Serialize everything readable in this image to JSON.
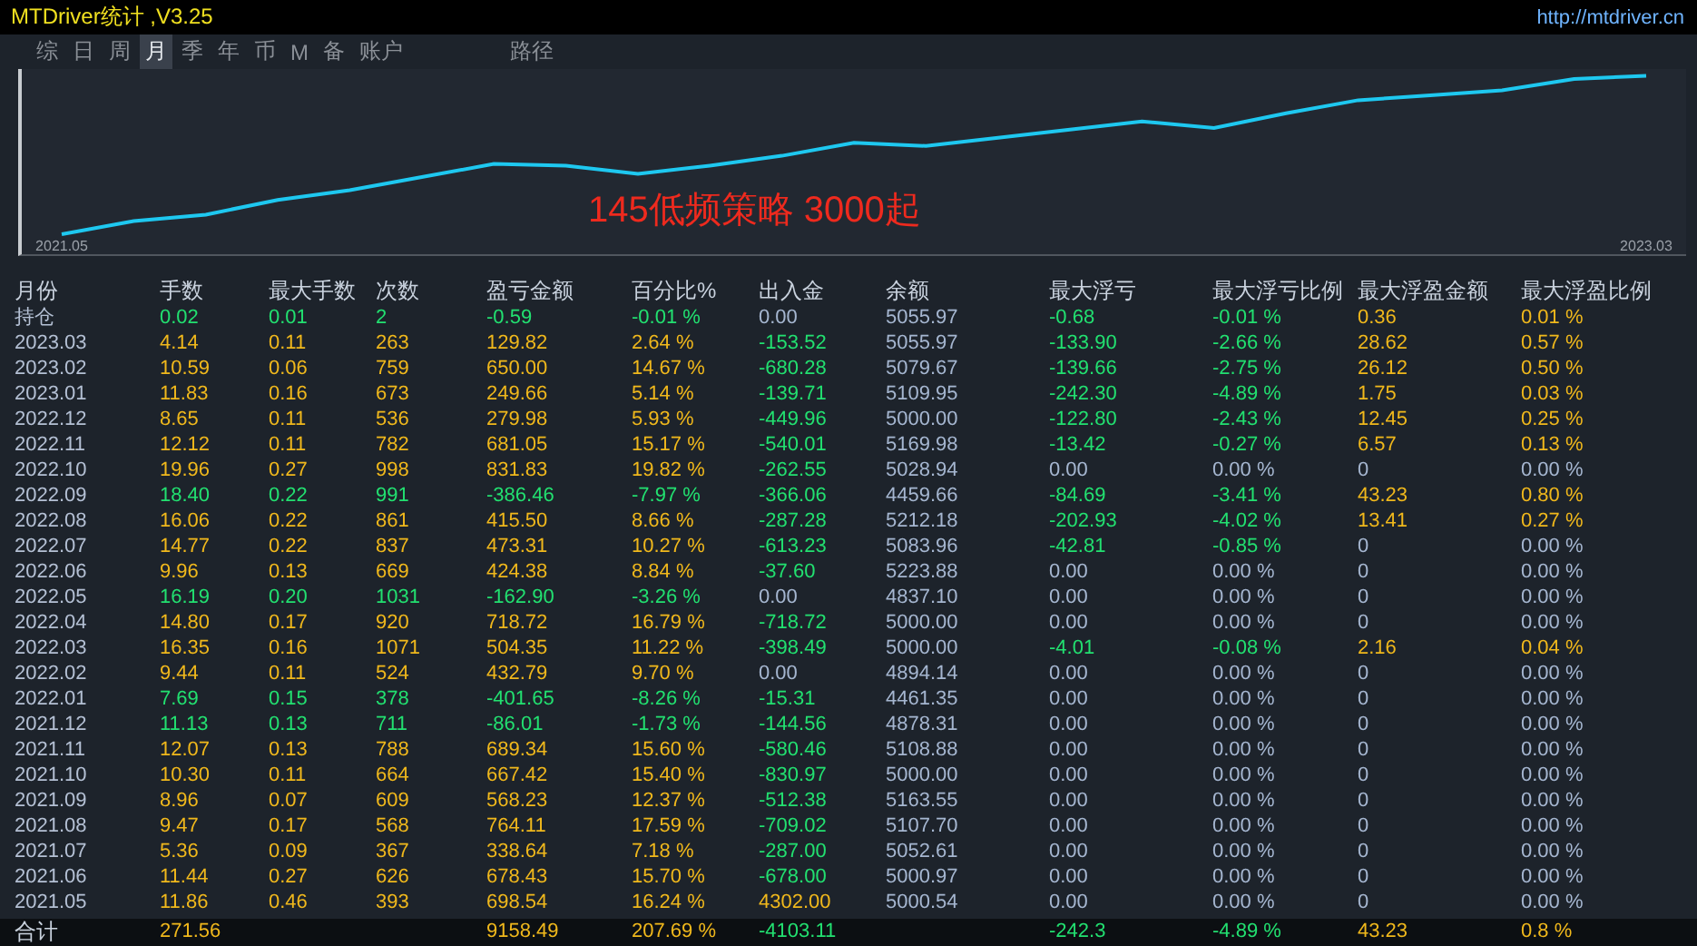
{
  "window": {
    "title": "MTDriver统计 ,V3.25",
    "link": "http://mtdriver.cn"
  },
  "tabs": [
    {
      "label": "综",
      "selected": false
    },
    {
      "label": "日",
      "selected": false
    },
    {
      "label": "周",
      "selected": false
    },
    {
      "label": "月",
      "selected": true
    },
    {
      "label": "季",
      "selected": false
    },
    {
      "label": "年",
      "selected": false
    },
    {
      "label": "币",
      "selected": false
    },
    {
      "label": "M",
      "selected": false
    },
    {
      "label": "备",
      "selected": false
    },
    {
      "label": "账户",
      "selected": false
    }
  ],
  "path_label": "路径",
  "chart": {
    "annotation": "145低频策略 3000起",
    "start_label": "2021.05",
    "end_label": "2023.03"
  },
  "table": {
    "columns": [
      "月份",
      "手数",
      "最大手数",
      "次数",
      "盈亏金额",
      "百分比%",
      "出入金",
      "余额",
      "最大浮亏",
      "最大浮亏比例",
      "最大浮盈金额",
      "最大浮盈比例"
    ],
    "rows": [
      {
        "cells": [
          {
            "text": "持仓",
            "kind": "month"
          },
          {
            "text": "0.02",
            "kind": "down"
          },
          {
            "text": "0.01",
            "kind": "down"
          },
          {
            "text": "2",
            "kind": "down"
          },
          {
            "text": "-0.59",
            "kind": "down"
          },
          {
            "text": "-0.01 %",
            "kind": "down"
          },
          {
            "text": "0.00",
            "kind": "flat"
          },
          {
            "text": "5055.97",
            "kind": "flat"
          },
          {
            "text": "-0.68",
            "kind": "down"
          },
          {
            "text": "-0.01 %",
            "kind": "down"
          },
          {
            "text": "0.36",
            "kind": "up"
          },
          {
            "text": "0.01 %",
            "kind": "up"
          }
        ]
      },
      {
        "cells": [
          {
            "text": "2023.03",
            "kind": "month"
          },
          {
            "text": "4.14",
            "kind": "up"
          },
          {
            "text": "0.11",
            "kind": "up"
          },
          {
            "text": "263",
            "kind": "up"
          },
          {
            "text": "129.82",
            "kind": "up"
          },
          {
            "text": "2.64 %",
            "kind": "up"
          },
          {
            "text": "-153.52",
            "kind": "down"
          },
          {
            "text": "5055.97",
            "kind": "flat"
          },
          {
            "text": "-133.90",
            "kind": "down"
          },
          {
            "text": "-2.66 %",
            "kind": "down"
          },
          {
            "text": "28.62",
            "kind": "up"
          },
          {
            "text": "0.57 %",
            "kind": "up"
          }
        ]
      },
      {
        "cells": [
          {
            "text": "2023.02",
            "kind": "month"
          },
          {
            "text": "10.59",
            "kind": "up"
          },
          {
            "text": "0.06",
            "kind": "up"
          },
          {
            "text": "759",
            "kind": "up"
          },
          {
            "text": "650.00",
            "kind": "up"
          },
          {
            "text": "14.67 %",
            "kind": "up"
          },
          {
            "text": "-680.28",
            "kind": "down"
          },
          {
            "text": "5079.67",
            "kind": "flat"
          },
          {
            "text": "-139.66",
            "kind": "down"
          },
          {
            "text": "-2.75 %",
            "kind": "down"
          },
          {
            "text": "26.12",
            "kind": "up"
          },
          {
            "text": "0.50 %",
            "kind": "up"
          }
        ]
      },
      {
        "cells": [
          {
            "text": "2023.01",
            "kind": "month"
          },
          {
            "text": "11.83",
            "kind": "up"
          },
          {
            "text": "0.16",
            "kind": "up"
          },
          {
            "text": "673",
            "kind": "up"
          },
          {
            "text": "249.66",
            "kind": "up"
          },
          {
            "text": "5.14 %",
            "kind": "up"
          },
          {
            "text": "-139.71",
            "kind": "down"
          },
          {
            "text": "5109.95",
            "kind": "flat"
          },
          {
            "text": "-242.30",
            "kind": "down"
          },
          {
            "text": "-4.89 %",
            "kind": "down"
          },
          {
            "text": "1.75",
            "kind": "up"
          },
          {
            "text": "0.03 %",
            "kind": "up"
          }
        ]
      },
      {
        "cells": [
          {
            "text": "2022.12",
            "kind": "month"
          },
          {
            "text": "8.65",
            "kind": "up"
          },
          {
            "text": "0.11",
            "kind": "up"
          },
          {
            "text": "536",
            "kind": "up"
          },
          {
            "text": "279.98",
            "kind": "up"
          },
          {
            "text": "5.93 %",
            "kind": "up"
          },
          {
            "text": "-449.96",
            "kind": "down"
          },
          {
            "text": "5000.00",
            "kind": "flat"
          },
          {
            "text": "-122.80",
            "kind": "down"
          },
          {
            "text": "-2.43 %",
            "kind": "down"
          },
          {
            "text": "12.45",
            "kind": "up"
          },
          {
            "text": "0.25 %",
            "kind": "up"
          }
        ]
      },
      {
        "cells": [
          {
            "text": "2022.11",
            "kind": "month"
          },
          {
            "text": "12.12",
            "kind": "up"
          },
          {
            "text": "0.11",
            "kind": "up"
          },
          {
            "text": "782",
            "kind": "up"
          },
          {
            "text": "681.05",
            "kind": "up"
          },
          {
            "text": "15.17 %",
            "kind": "up"
          },
          {
            "text": "-540.01",
            "kind": "down"
          },
          {
            "text": "5169.98",
            "kind": "flat"
          },
          {
            "text": "-13.42",
            "kind": "down"
          },
          {
            "text": "-0.27 %",
            "kind": "down"
          },
          {
            "text": "6.57",
            "kind": "up"
          },
          {
            "text": "0.13 %",
            "kind": "up"
          }
        ]
      },
      {
        "cells": [
          {
            "text": "2022.10",
            "kind": "month"
          },
          {
            "text": "19.96",
            "kind": "up"
          },
          {
            "text": "0.27",
            "kind": "up"
          },
          {
            "text": "998",
            "kind": "up"
          },
          {
            "text": "831.83",
            "kind": "up"
          },
          {
            "text": "19.82 %",
            "kind": "up"
          },
          {
            "text": "-262.55",
            "kind": "down"
          },
          {
            "text": "5028.94",
            "kind": "flat"
          },
          {
            "text": "0.00",
            "kind": "flat"
          },
          {
            "text": "0.00 %",
            "kind": "flat"
          },
          {
            "text": "0",
            "kind": "flat"
          },
          {
            "text": "0.00 %",
            "kind": "flat"
          }
        ]
      },
      {
        "cells": [
          {
            "text": "2022.09",
            "kind": "month"
          },
          {
            "text": "18.40",
            "kind": "down"
          },
          {
            "text": "0.22",
            "kind": "down"
          },
          {
            "text": "991",
            "kind": "down"
          },
          {
            "text": "-386.46",
            "kind": "down"
          },
          {
            "text": "-7.97 %",
            "kind": "down"
          },
          {
            "text": "-366.06",
            "kind": "down"
          },
          {
            "text": "4459.66",
            "kind": "flat"
          },
          {
            "text": "-84.69",
            "kind": "down"
          },
          {
            "text": "-3.41 %",
            "kind": "down"
          },
          {
            "text": "43.23",
            "kind": "up"
          },
          {
            "text": "0.80 %",
            "kind": "up"
          }
        ]
      },
      {
        "cells": [
          {
            "text": "2022.08",
            "kind": "month"
          },
          {
            "text": "16.06",
            "kind": "up"
          },
          {
            "text": "0.22",
            "kind": "up"
          },
          {
            "text": "861",
            "kind": "up"
          },
          {
            "text": "415.50",
            "kind": "up"
          },
          {
            "text": "8.66 %",
            "kind": "up"
          },
          {
            "text": "-287.28",
            "kind": "down"
          },
          {
            "text": "5212.18",
            "kind": "flat"
          },
          {
            "text": "-202.93",
            "kind": "down"
          },
          {
            "text": "-4.02 %",
            "kind": "down"
          },
          {
            "text": "13.41",
            "kind": "up"
          },
          {
            "text": "0.27 %",
            "kind": "up"
          }
        ]
      },
      {
        "cells": [
          {
            "text": "2022.07",
            "kind": "month"
          },
          {
            "text": "14.77",
            "kind": "up"
          },
          {
            "text": "0.22",
            "kind": "up"
          },
          {
            "text": "837",
            "kind": "up"
          },
          {
            "text": "473.31",
            "kind": "up"
          },
          {
            "text": "10.27 %",
            "kind": "up"
          },
          {
            "text": "-613.23",
            "kind": "down"
          },
          {
            "text": "5083.96",
            "kind": "flat"
          },
          {
            "text": "-42.81",
            "kind": "down"
          },
          {
            "text": "-0.85 %",
            "kind": "down"
          },
          {
            "text": "0",
            "kind": "flat"
          },
          {
            "text": "0.00 %",
            "kind": "flat"
          }
        ]
      },
      {
        "cells": [
          {
            "text": "2022.06",
            "kind": "month"
          },
          {
            "text": "9.96",
            "kind": "up"
          },
          {
            "text": "0.13",
            "kind": "up"
          },
          {
            "text": "669",
            "kind": "up"
          },
          {
            "text": "424.38",
            "kind": "up"
          },
          {
            "text": "8.84 %",
            "kind": "up"
          },
          {
            "text": "-37.60",
            "kind": "down"
          },
          {
            "text": "5223.88",
            "kind": "flat"
          },
          {
            "text": "0.00",
            "kind": "flat"
          },
          {
            "text": "0.00 %",
            "kind": "flat"
          },
          {
            "text": "0",
            "kind": "flat"
          },
          {
            "text": "0.00 %",
            "kind": "flat"
          }
        ]
      },
      {
        "cells": [
          {
            "text": "2022.05",
            "kind": "month"
          },
          {
            "text": "16.19",
            "kind": "down"
          },
          {
            "text": "0.20",
            "kind": "down"
          },
          {
            "text": "1031",
            "kind": "down"
          },
          {
            "text": "-162.90",
            "kind": "down"
          },
          {
            "text": "-3.26 %",
            "kind": "down"
          },
          {
            "text": "0.00",
            "kind": "flat"
          },
          {
            "text": "4837.10",
            "kind": "flat"
          },
          {
            "text": "0.00",
            "kind": "flat"
          },
          {
            "text": "0.00 %",
            "kind": "flat"
          },
          {
            "text": "0",
            "kind": "flat"
          },
          {
            "text": "0.00 %",
            "kind": "flat"
          }
        ]
      },
      {
        "cells": [
          {
            "text": "2022.04",
            "kind": "month"
          },
          {
            "text": "14.80",
            "kind": "up"
          },
          {
            "text": "0.17",
            "kind": "up"
          },
          {
            "text": "920",
            "kind": "up"
          },
          {
            "text": "718.72",
            "kind": "up"
          },
          {
            "text": "16.79 %",
            "kind": "up"
          },
          {
            "text": "-718.72",
            "kind": "down"
          },
          {
            "text": "5000.00",
            "kind": "flat"
          },
          {
            "text": "0.00",
            "kind": "flat"
          },
          {
            "text": "0.00 %",
            "kind": "flat"
          },
          {
            "text": "0",
            "kind": "flat"
          },
          {
            "text": "0.00 %",
            "kind": "flat"
          }
        ]
      },
      {
        "cells": [
          {
            "text": "2022.03",
            "kind": "month"
          },
          {
            "text": "16.35",
            "kind": "up"
          },
          {
            "text": "0.16",
            "kind": "up"
          },
          {
            "text": "1071",
            "kind": "up"
          },
          {
            "text": "504.35",
            "kind": "up"
          },
          {
            "text": "11.22 %",
            "kind": "up"
          },
          {
            "text": "-398.49",
            "kind": "down"
          },
          {
            "text": "5000.00",
            "kind": "flat"
          },
          {
            "text": "-4.01",
            "kind": "down"
          },
          {
            "text": "-0.08 %",
            "kind": "down"
          },
          {
            "text": "2.16",
            "kind": "up"
          },
          {
            "text": "0.04 %",
            "kind": "up"
          }
        ]
      },
      {
        "cells": [
          {
            "text": "2022.02",
            "kind": "month"
          },
          {
            "text": "9.44",
            "kind": "up"
          },
          {
            "text": "0.11",
            "kind": "up"
          },
          {
            "text": "524",
            "kind": "up"
          },
          {
            "text": "432.79",
            "kind": "up"
          },
          {
            "text": "9.70 %",
            "kind": "up"
          },
          {
            "text": "0.00",
            "kind": "flat"
          },
          {
            "text": "4894.14",
            "kind": "flat"
          },
          {
            "text": "0.00",
            "kind": "flat"
          },
          {
            "text": "0.00 %",
            "kind": "flat"
          },
          {
            "text": "0",
            "kind": "flat"
          },
          {
            "text": "0.00 %",
            "kind": "flat"
          }
        ]
      },
      {
        "cells": [
          {
            "text": "2022.01",
            "kind": "month"
          },
          {
            "text": "7.69",
            "kind": "down"
          },
          {
            "text": "0.15",
            "kind": "down"
          },
          {
            "text": "378",
            "kind": "down"
          },
          {
            "text": "-401.65",
            "kind": "down"
          },
          {
            "text": "-8.26 %",
            "kind": "down"
          },
          {
            "text": "-15.31",
            "kind": "down"
          },
          {
            "text": "4461.35",
            "kind": "flat"
          },
          {
            "text": "0.00",
            "kind": "flat"
          },
          {
            "text": "0.00 %",
            "kind": "flat"
          },
          {
            "text": "0",
            "kind": "flat"
          },
          {
            "text": "0.00 %",
            "kind": "flat"
          }
        ]
      },
      {
        "cells": [
          {
            "text": "2021.12",
            "kind": "month"
          },
          {
            "text": "11.13",
            "kind": "down"
          },
          {
            "text": "0.13",
            "kind": "down"
          },
          {
            "text": "711",
            "kind": "down"
          },
          {
            "text": "-86.01",
            "kind": "down"
          },
          {
            "text": "-1.73 %",
            "kind": "down"
          },
          {
            "text": "-144.56",
            "kind": "down"
          },
          {
            "text": "4878.31",
            "kind": "flat"
          },
          {
            "text": "0.00",
            "kind": "flat"
          },
          {
            "text": "0.00 %",
            "kind": "flat"
          },
          {
            "text": "0",
            "kind": "flat"
          },
          {
            "text": "0.00 %",
            "kind": "flat"
          }
        ]
      },
      {
        "cells": [
          {
            "text": "2021.11",
            "kind": "month"
          },
          {
            "text": "12.07",
            "kind": "up"
          },
          {
            "text": "0.13",
            "kind": "up"
          },
          {
            "text": "788",
            "kind": "up"
          },
          {
            "text": "689.34",
            "kind": "up"
          },
          {
            "text": "15.60 %",
            "kind": "up"
          },
          {
            "text": "-580.46",
            "kind": "down"
          },
          {
            "text": "5108.88",
            "kind": "flat"
          },
          {
            "text": "0.00",
            "kind": "flat"
          },
          {
            "text": "0.00 %",
            "kind": "flat"
          },
          {
            "text": "0",
            "kind": "flat"
          },
          {
            "text": "0.00 %",
            "kind": "flat"
          }
        ]
      },
      {
        "cells": [
          {
            "text": "2021.10",
            "kind": "month"
          },
          {
            "text": "10.30",
            "kind": "up"
          },
          {
            "text": "0.11",
            "kind": "up"
          },
          {
            "text": "664",
            "kind": "up"
          },
          {
            "text": "667.42",
            "kind": "up"
          },
          {
            "text": "15.40 %",
            "kind": "up"
          },
          {
            "text": "-830.97",
            "kind": "down"
          },
          {
            "text": "5000.00",
            "kind": "flat"
          },
          {
            "text": "0.00",
            "kind": "flat"
          },
          {
            "text": "0.00 %",
            "kind": "flat"
          },
          {
            "text": "0",
            "kind": "flat"
          },
          {
            "text": "0.00 %",
            "kind": "flat"
          }
        ]
      },
      {
        "cells": [
          {
            "text": "2021.09",
            "kind": "month"
          },
          {
            "text": "8.96",
            "kind": "up"
          },
          {
            "text": "0.07",
            "kind": "up"
          },
          {
            "text": "609",
            "kind": "up"
          },
          {
            "text": "568.23",
            "kind": "up"
          },
          {
            "text": "12.37 %",
            "kind": "up"
          },
          {
            "text": "-512.38",
            "kind": "down"
          },
          {
            "text": "5163.55",
            "kind": "flat"
          },
          {
            "text": "0.00",
            "kind": "flat"
          },
          {
            "text": "0.00 %",
            "kind": "flat"
          },
          {
            "text": "0",
            "kind": "flat"
          },
          {
            "text": "0.00 %",
            "kind": "flat"
          }
        ]
      },
      {
        "cells": [
          {
            "text": "2021.08",
            "kind": "month"
          },
          {
            "text": "9.47",
            "kind": "up"
          },
          {
            "text": "0.17",
            "kind": "up"
          },
          {
            "text": "568",
            "kind": "up"
          },
          {
            "text": "764.11",
            "kind": "up"
          },
          {
            "text": "17.59 %",
            "kind": "up"
          },
          {
            "text": "-709.02",
            "kind": "down"
          },
          {
            "text": "5107.70",
            "kind": "flat"
          },
          {
            "text": "0.00",
            "kind": "flat"
          },
          {
            "text": "0.00 %",
            "kind": "flat"
          },
          {
            "text": "0",
            "kind": "flat"
          },
          {
            "text": "0.00 %",
            "kind": "flat"
          }
        ]
      },
      {
        "cells": [
          {
            "text": "2021.07",
            "kind": "month"
          },
          {
            "text": "5.36",
            "kind": "up"
          },
          {
            "text": "0.09",
            "kind": "up"
          },
          {
            "text": "367",
            "kind": "up"
          },
          {
            "text": "338.64",
            "kind": "up"
          },
          {
            "text": "7.18 %",
            "kind": "up"
          },
          {
            "text": "-287.00",
            "kind": "down"
          },
          {
            "text": "5052.61",
            "kind": "flat"
          },
          {
            "text": "0.00",
            "kind": "flat"
          },
          {
            "text": "0.00 %",
            "kind": "flat"
          },
          {
            "text": "0",
            "kind": "flat"
          },
          {
            "text": "0.00 %",
            "kind": "flat"
          }
        ]
      },
      {
        "cells": [
          {
            "text": "2021.06",
            "kind": "month"
          },
          {
            "text": "11.44",
            "kind": "up"
          },
          {
            "text": "0.27",
            "kind": "up"
          },
          {
            "text": "626",
            "kind": "up"
          },
          {
            "text": "678.43",
            "kind": "up"
          },
          {
            "text": "15.70 %",
            "kind": "up"
          },
          {
            "text": "-678.00",
            "kind": "down"
          },
          {
            "text": "5000.97",
            "kind": "flat"
          },
          {
            "text": "0.00",
            "kind": "flat"
          },
          {
            "text": "0.00 %",
            "kind": "flat"
          },
          {
            "text": "0",
            "kind": "flat"
          },
          {
            "text": "0.00 %",
            "kind": "flat"
          }
        ]
      },
      {
        "cells": [
          {
            "text": "2021.05",
            "kind": "month"
          },
          {
            "text": "11.86",
            "kind": "up"
          },
          {
            "text": "0.46",
            "kind": "up"
          },
          {
            "text": "393",
            "kind": "up"
          },
          {
            "text": "698.54",
            "kind": "up"
          },
          {
            "text": "16.24 %",
            "kind": "up"
          },
          {
            "text": "4302.00",
            "kind": "up"
          },
          {
            "text": "5000.54",
            "kind": "flat"
          },
          {
            "text": "0.00",
            "kind": "flat"
          },
          {
            "text": "0.00 %",
            "kind": "flat"
          },
          {
            "text": "0",
            "kind": "flat"
          },
          {
            "text": "0.00 %",
            "kind": "flat"
          }
        ]
      }
    ],
    "total": {
      "cells": [
        {
          "text": "合计",
          "kind": "month"
        },
        {
          "text": "271.56",
          "kind": "up"
        },
        null,
        null,
        {
          "text": "9158.49",
          "kind": "up"
        },
        {
          "text": "207.69 %",
          "kind": "up"
        },
        {
          "text": "-4103.11",
          "kind": "down"
        },
        null,
        {
          "text": "-242.3",
          "kind": "down"
        },
        {
          "text": "-4.89 %",
          "kind": "down"
        },
        {
          "text": "43.23",
          "kind": "up"
        },
        {
          "text": "0.8 %",
          "kind": "up"
        }
      ]
    }
  }
}
